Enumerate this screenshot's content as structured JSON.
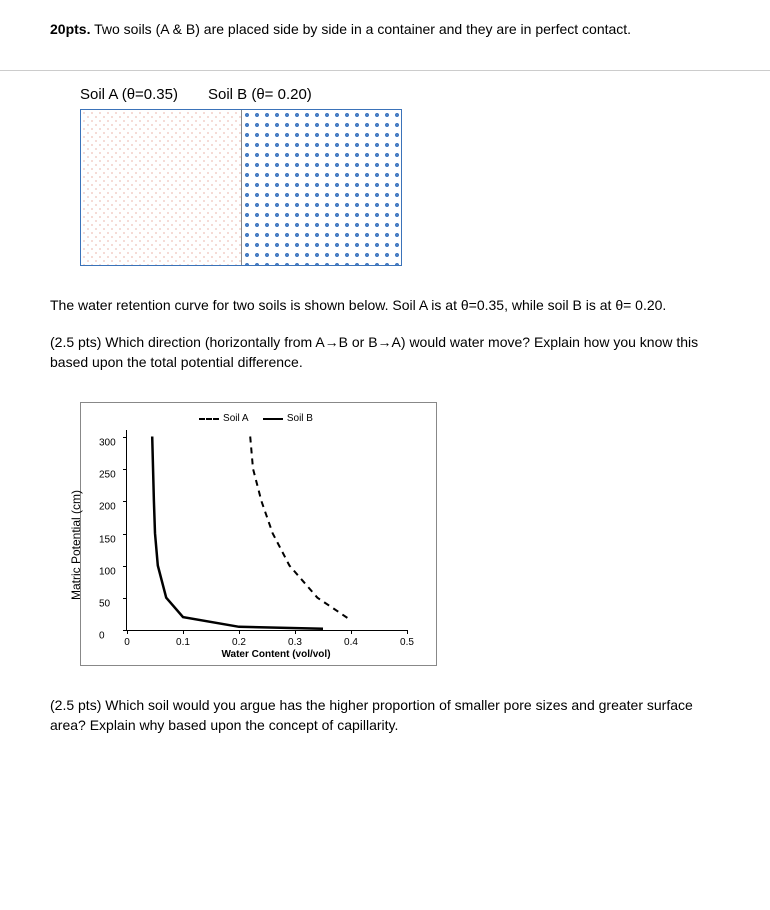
{
  "intro": {
    "points": "20pts.",
    "text": " Two soils (A & B) are placed side by side in a container and they are in perfect contact."
  },
  "diagram": {
    "soilA_label": "Soil A (θ=0.35)",
    "soilB_label": "Soil B (θ= 0.20)"
  },
  "retention_text": "The water retention curve for two soils is shown below. Soil A is at θ=0.35, while soil B is at θ= 0.20.",
  "q1": "(2.5 pts) Which direction (horizontally from A→B or B→A) would water move? Explain how you know this based upon the total potential difference.",
  "q2": "(2.5 pts) Which soil would you argue has the higher proportion of smaller pore sizes and greater surface area? Explain why based upon the concept of capillarity.",
  "chart_data": {
    "type": "line",
    "title": "",
    "xlabel": "Water Content (vol/vol)",
    "ylabel": "Matric Potential (cm)",
    "xlim": [
      0,
      0.5
    ],
    "ylim": [
      0,
      310
    ],
    "x_ticks": [
      0,
      0.1,
      0.2,
      0.3,
      0.4,
      0.5
    ],
    "y_ticks": [
      0,
      50,
      100,
      150,
      200,
      250,
      300
    ],
    "legend": {
      "soilA": "Soil A",
      "soilB": "Soil B"
    },
    "series": [
      {
        "name": "Soil A",
        "style": "dashed",
        "points": [
          {
            "x": 0.22,
            "y": 300
          },
          {
            "x": 0.225,
            "y": 250
          },
          {
            "x": 0.24,
            "y": 200
          },
          {
            "x": 0.26,
            "y": 150
          },
          {
            "x": 0.29,
            "y": 100
          },
          {
            "x": 0.34,
            "y": 50
          },
          {
            "x": 0.4,
            "y": 15
          }
        ]
      },
      {
        "name": "Soil B",
        "style": "solid",
        "points": [
          {
            "x": 0.045,
            "y": 300
          },
          {
            "x": 0.048,
            "y": 200
          },
          {
            "x": 0.05,
            "y": 150
          },
          {
            "x": 0.055,
            "y": 100
          },
          {
            "x": 0.07,
            "y": 50
          },
          {
            "x": 0.1,
            "y": 20
          },
          {
            "x": 0.2,
            "y": 5
          },
          {
            "x": 0.35,
            "y": 2
          }
        ]
      }
    ]
  }
}
